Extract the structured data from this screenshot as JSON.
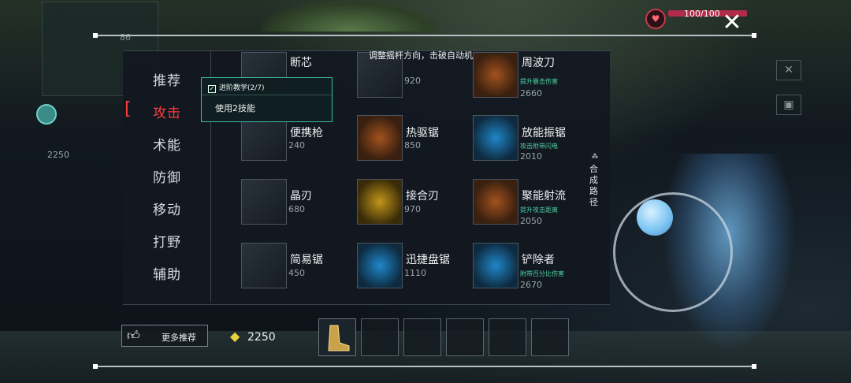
{
  "hud": {
    "minimap_number": "86",
    "hp_text": "100/100",
    "gold_left": "2250",
    "close_icon": "close-icon"
  },
  "hint_text": "调整摇杆方向，击破自动机",
  "categories": [
    {
      "label": "推荐",
      "active": false
    },
    {
      "label": "攻击",
      "active": true
    },
    {
      "label": "术能",
      "active": false
    },
    {
      "label": "防御",
      "active": false
    },
    {
      "label": "移动",
      "active": false
    },
    {
      "label": "打野",
      "active": false
    },
    {
      "label": "辅助",
      "active": false
    }
  ],
  "tutorial": {
    "title": "进阶教学(2/7)",
    "body": "使用2技能"
  },
  "items": [
    {
      "name": "断芯",
      "price": "",
      "desc": ""
    },
    {
      "name": "",
      "price": "920",
      "desc": ""
    },
    {
      "name": "周波刀",
      "price": "2660",
      "desc": "提升暴击伤害"
    },
    {
      "name": "便携枪",
      "price": "240",
      "desc": ""
    },
    {
      "name": "热驱锯",
      "price": "850",
      "desc": ""
    },
    {
      "name": "放能振锯",
      "price": "2010",
      "desc": "攻击附带闪电"
    },
    {
      "name": "晶刃",
      "price": "680",
      "desc": ""
    },
    {
      "name": "接合刃",
      "price": "970",
      "desc": ""
    },
    {
      "name": "聚能射流",
      "price": "2050",
      "desc": "提升攻击距离"
    },
    {
      "name": "简易锯",
      "price": "450",
      "desc": ""
    },
    {
      "name": "迅捷盘锯",
      "price": "1110",
      "desc": ""
    },
    {
      "name": "铲除者",
      "price": "2670",
      "desc": "附带百分比伤害"
    }
  ],
  "synth_path": "合成路径",
  "bottom": {
    "recommend_label": "更多推荐",
    "gold": "2250"
  },
  "colors": {
    "accent_red": "#ff3b3b",
    "tooltip_border": "#3fb9a4",
    "desc_green": "#4fd0a4",
    "gold": "#e6d23a"
  }
}
